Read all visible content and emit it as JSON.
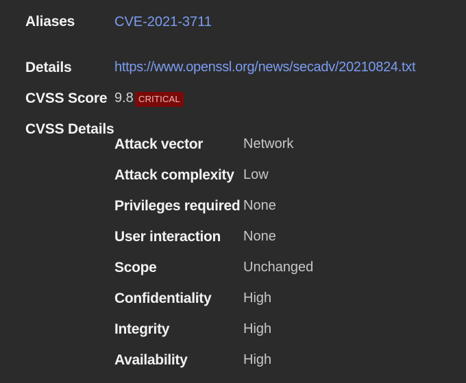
{
  "aliases": {
    "label": "Aliases",
    "value": "CVE-2021-3711"
  },
  "details": {
    "label": "Details",
    "url": "https://www.openssl.org/news/secadv/20210824.txt"
  },
  "cvss_score": {
    "label": "CVSS Score",
    "value": "9.8",
    "severity": "CRITICAL",
    "severity_color": "#7a0a0a"
  },
  "cvss_details": {
    "label": "CVSS Details",
    "rows": [
      {
        "key": "Attack vector",
        "value": "Network"
      },
      {
        "key": "Attack complexity",
        "value": "Low"
      },
      {
        "key": "Privileges required",
        "value": "None"
      },
      {
        "key": "User interaction",
        "value": "None"
      },
      {
        "key": "Scope",
        "value": "Unchanged"
      },
      {
        "key": "Confidentiality",
        "value": "High"
      },
      {
        "key": "Integrity",
        "value": "High"
      },
      {
        "key": "Availability",
        "value": "High"
      }
    ]
  },
  "colors": {
    "background": "#2b2b2b",
    "link": "#7b9cf0"
  }
}
